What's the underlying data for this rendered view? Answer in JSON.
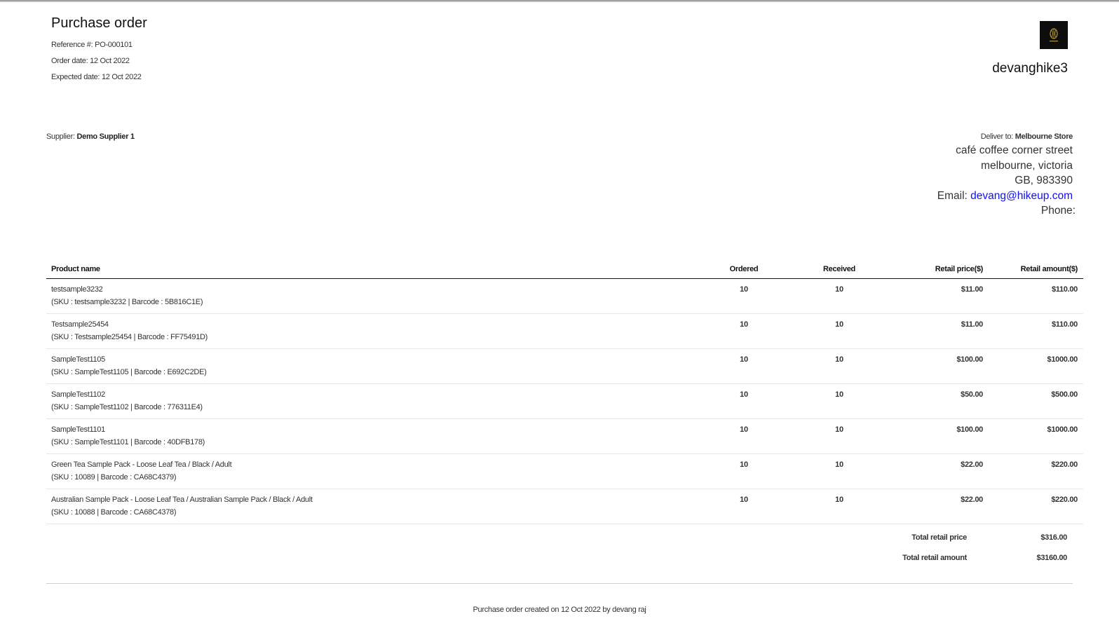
{
  "document": {
    "title": "Purchase order",
    "reference_label": "Reference #:",
    "reference": "PO-000101",
    "order_date_label": "Order date:",
    "order_date": "12 Oct 2022",
    "expected_date_label": "Expected date:",
    "expected_date": "12 Oct 2022"
  },
  "store": {
    "name": "devanghike3"
  },
  "supplier": {
    "label": "Supplier:",
    "name": "Demo Supplier 1"
  },
  "deliver": {
    "label": "Deliver to:",
    "name": "Melbourne Store",
    "address_line1": "café coffee corner street",
    "address_line2": "melbourne, victoria",
    "address_line3": "GB, 983390",
    "email_label": "Email:",
    "email": "devang@hikeup.com",
    "phone_label": "Phone:"
  },
  "table": {
    "headers": [
      "Product name",
      "Ordered",
      "Received",
      "Retail price($)",
      "Retail amount($)"
    ],
    "rows": [
      {
        "name": "testsample3232",
        "sku": "(SKU : testsample3232 | Barcode : 5B816C1E)",
        "ordered": "10",
        "received": "10",
        "price": "$11.00",
        "amount": "$110.00"
      },
      {
        "name": "Testsample25454",
        "sku": "(SKU : Testsample25454 | Barcode : FF75491D)",
        "ordered": "10",
        "received": "10",
        "price": "$11.00",
        "amount": "$110.00"
      },
      {
        "name": "SampleTest1105",
        "sku": "(SKU : SampleTest1105 | Barcode : E692C2DE)",
        "ordered": "10",
        "received": "10",
        "price": "$100.00",
        "amount": "$1000.00"
      },
      {
        "name": "SampleTest1102",
        "sku": "(SKU : SampleTest1102 | Barcode : 776311E4)",
        "ordered": "10",
        "received": "10",
        "price": "$50.00",
        "amount": "$500.00"
      },
      {
        "name": "SampleTest1101",
        "sku": "(SKU : SampleTest1101 | Barcode : 40DFB178)",
        "ordered": "10",
        "received": "10",
        "price": "$100.00",
        "amount": "$1000.00"
      },
      {
        "name": "Green Tea Sample Pack - Loose Leaf Tea / Black / Adult",
        "sku": "(SKU : 10089 | Barcode : CA68C4379)",
        "ordered": "10",
        "received": "10",
        "price": "$22.00",
        "amount": "$220.00"
      },
      {
        "name": "Australian Sample Pack - Loose Leaf Tea / Australian Sample Pack / Black / Adult",
        "sku": "(SKU : 10088 | Barcode : CA68C4378)",
        "ordered": "10",
        "received": "10",
        "price": "$22.00",
        "amount": "$220.00"
      }
    ]
  },
  "totals": {
    "retail_price_label": "Total retail price",
    "retail_price": "$316.00",
    "retail_amount_label": "Total retail amount",
    "retail_amount": "$3160.00"
  },
  "footer": {
    "text": "Purchase order created on 12 Oct 2022 by devang raj"
  },
  "colors": {
    "link": "#1010ee",
    "logo_bg": "#0d0d0d",
    "logo_accent": "#b8963c"
  },
  "icons": {
    "logo": "brand-logo-icon"
  }
}
